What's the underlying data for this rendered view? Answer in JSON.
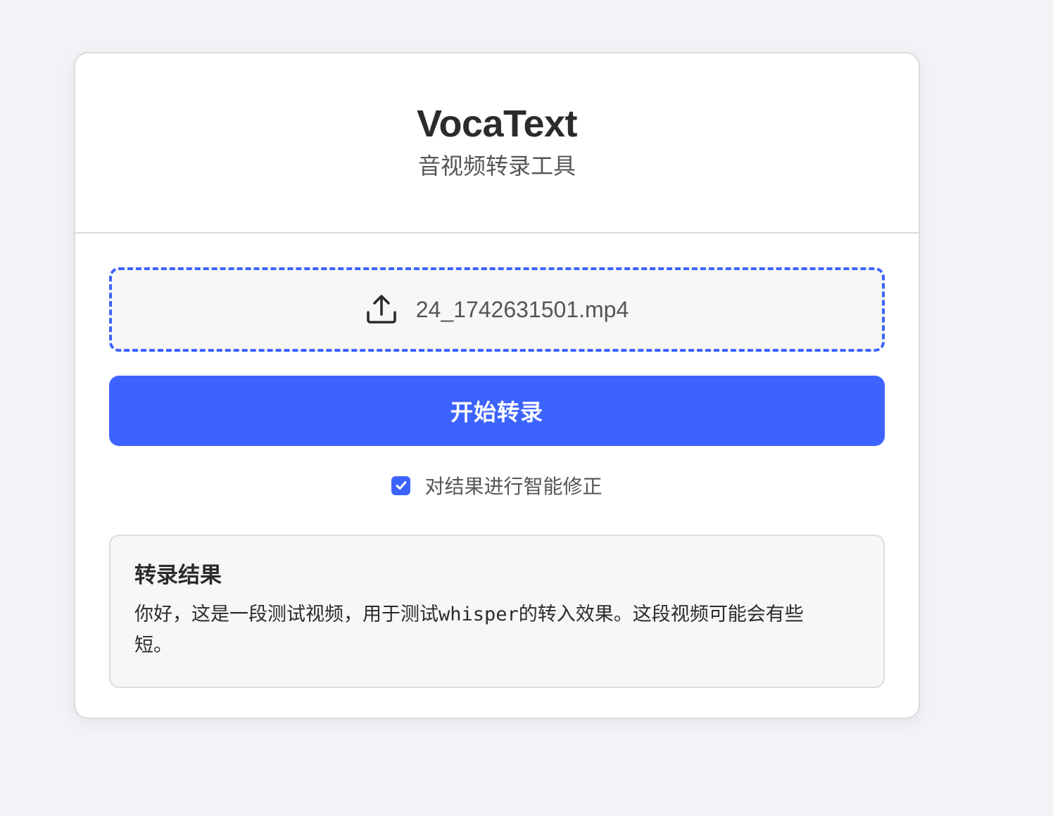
{
  "header": {
    "title": "VocaText",
    "subtitle": "音视频转录工具"
  },
  "upload": {
    "icon": "upload-icon",
    "filename": "24_1742631501.mp4",
    "accent_color": "#3d63ff"
  },
  "actions": {
    "start_label": "开始转录"
  },
  "options": {
    "smart_correction_label": "对结果进行智能修正",
    "smart_correction_checked": true
  },
  "result": {
    "title": "转录结果",
    "text": "你好，这是一段测试视频，用于测试whisper的转入效果。这段视频可能会有些短。"
  }
}
